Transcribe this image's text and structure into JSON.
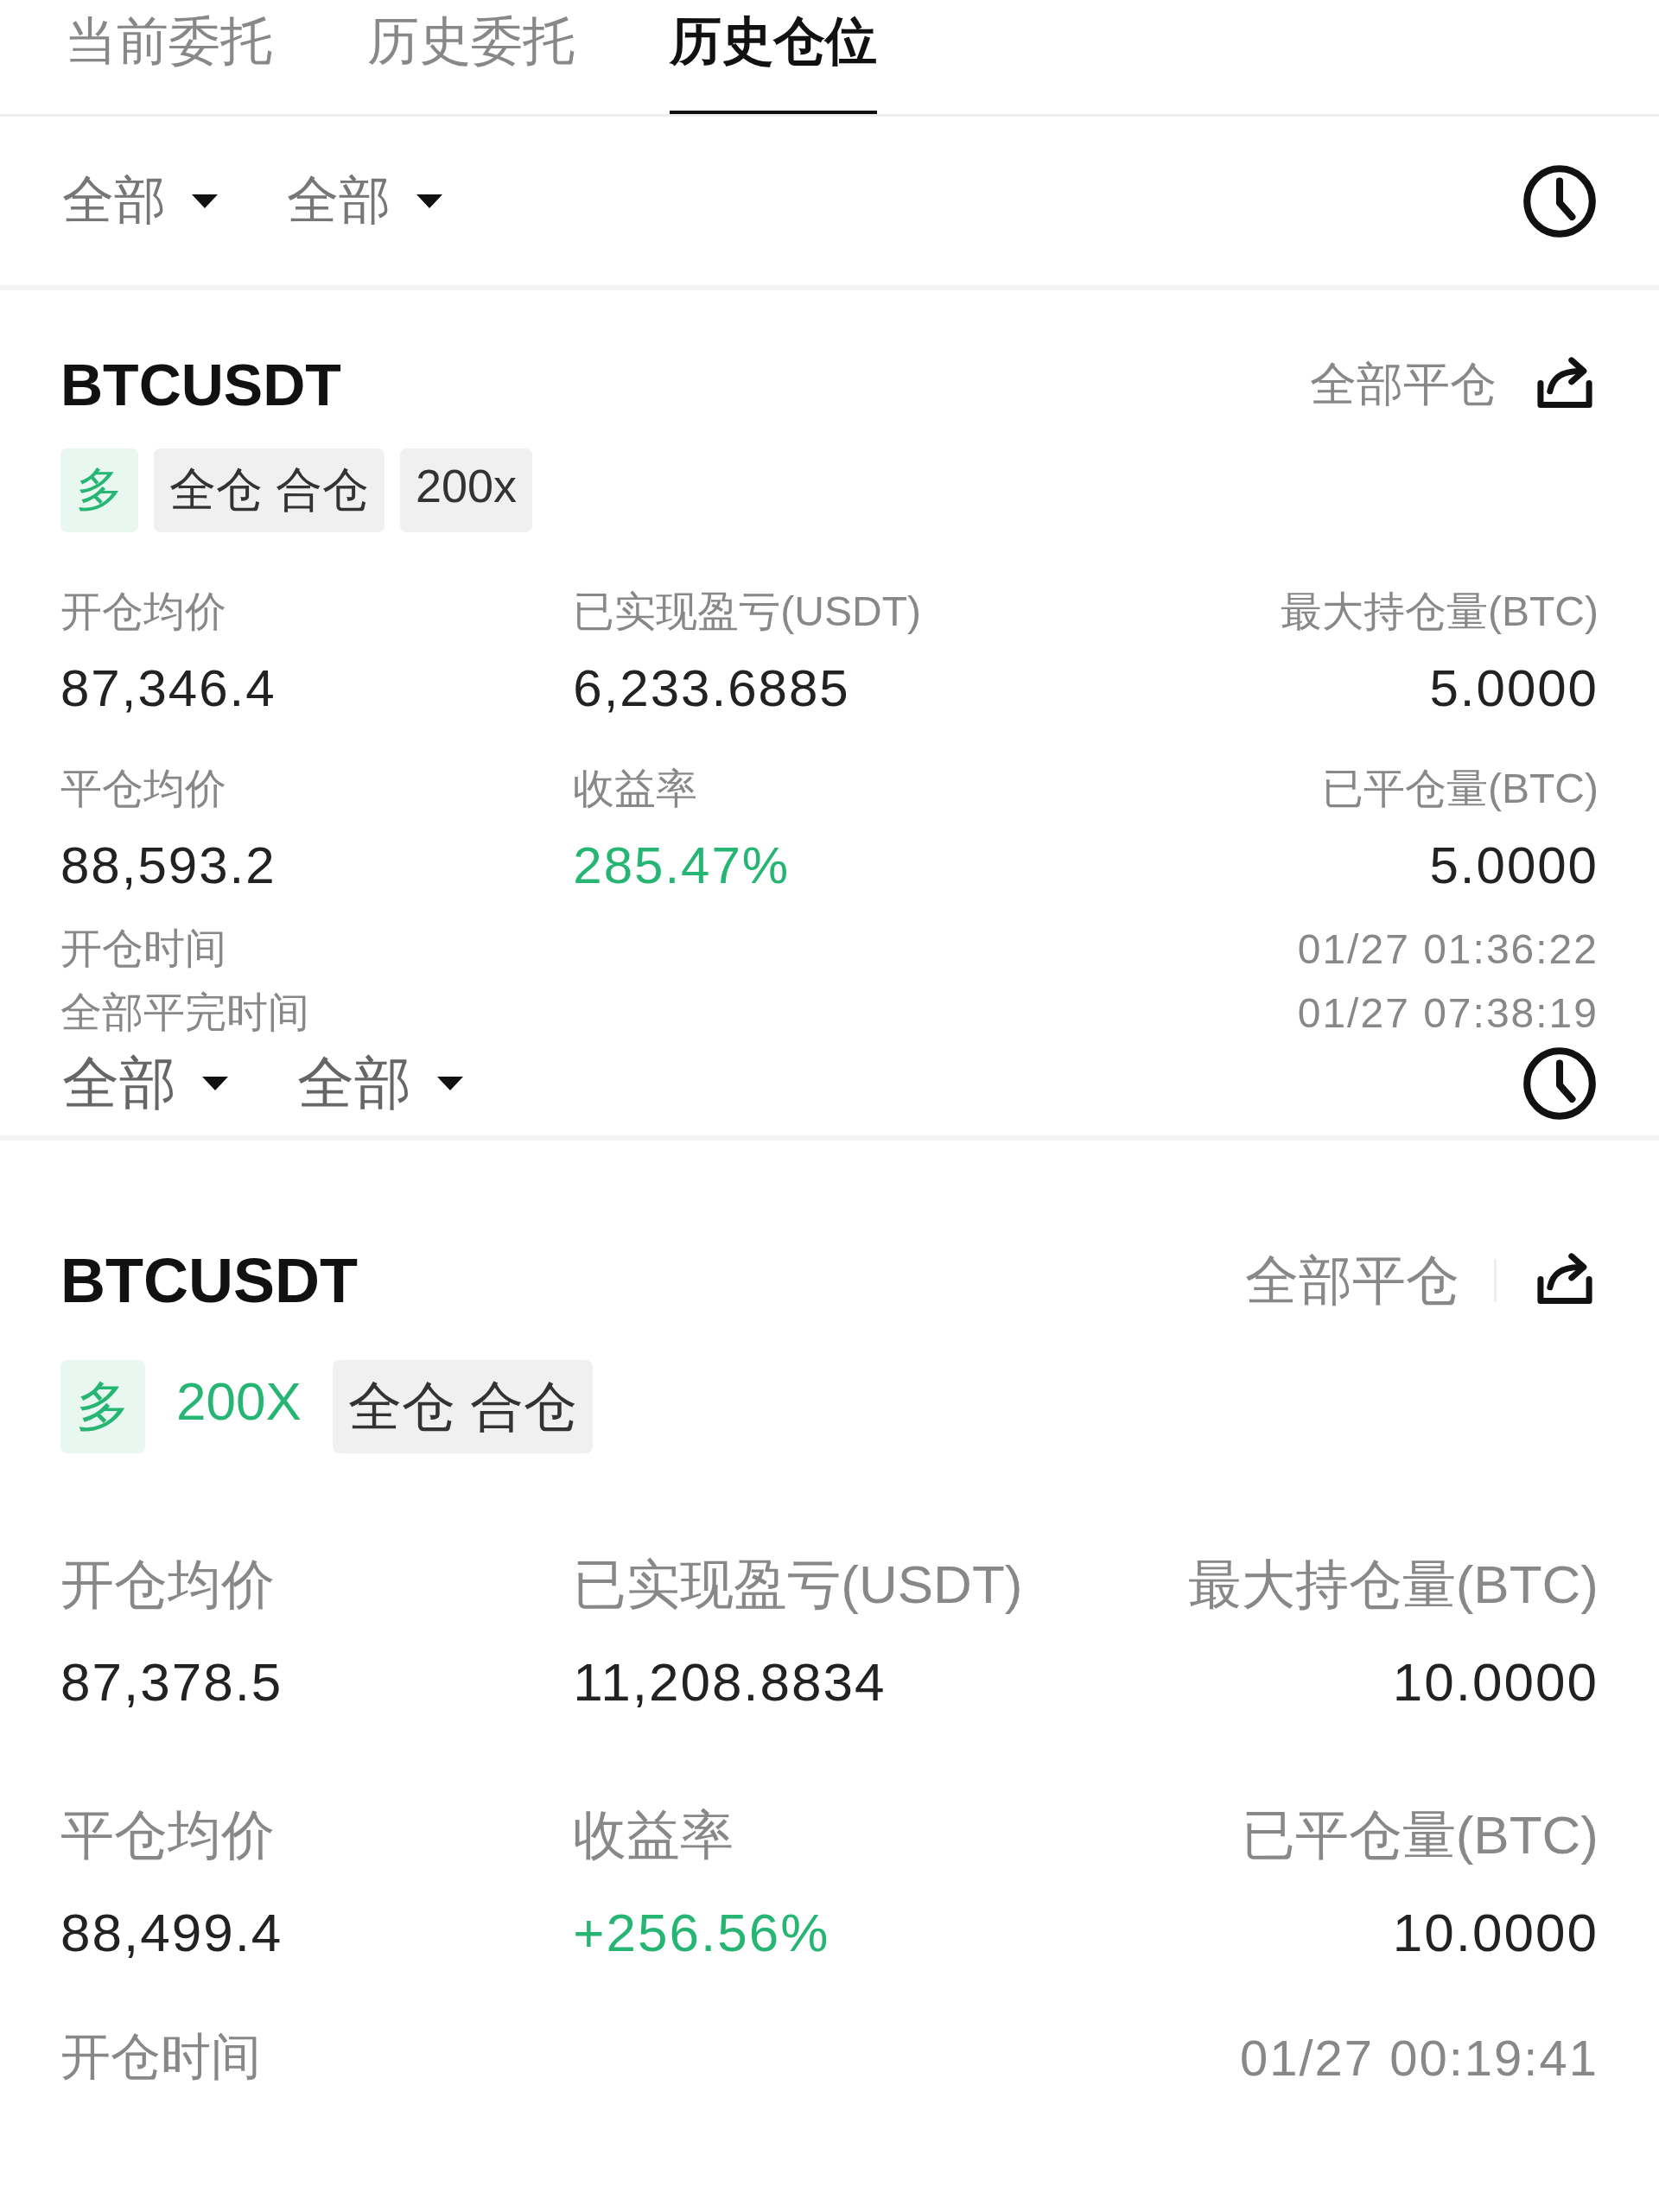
{
  "tabs": [
    {
      "label": "当前委托",
      "selected": false
    },
    {
      "label": "历史委托",
      "selected": false
    },
    {
      "label": "历史仓位",
      "selected": true
    }
  ],
  "sections": [
    {
      "filters": [
        "全部",
        "全部"
      ],
      "position": {
        "symbol": "BTCUSDT",
        "close_all": "全部平仓",
        "tags": [
          {
            "kind": "side",
            "text": "多"
          },
          {
            "kind": "grey",
            "text": "全仓 合仓"
          },
          {
            "kind": "grey",
            "text": "200x"
          }
        ],
        "stats": [
          {
            "label": "开仓均价",
            "value": "87,346.4",
            "kind": "number"
          },
          {
            "label": "已实现盈亏(USDT)",
            "value": "6,233.6885",
            "kind": "number"
          },
          {
            "label": "最大持仓量(BTC)",
            "value": "5.0000",
            "kind": "number"
          },
          {
            "label": "平仓均价",
            "value": "88,593.2",
            "kind": "number"
          },
          {
            "label": "收益率",
            "value": "285.47%",
            "kind": "profit"
          },
          {
            "label": "已平仓量(BTC)",
            "value": "5.0000",
            "kind": "number"
          }
        ],
        "times": [
          {
            "label": "开仓时间",
            "value": "01/27 01:36:22"
          },
          {
            "label": "全部平完时间",
            "value": "01/27 07:38:19"
          }
        ]
      }
    },
    {
      "filters": [
        "全部",
        "全部"
      ],
      "position": {
        "symbol": "BTCUSDT",
        "close_all": "全部平仓",
        "tags": [
          {
            "kind": "side",
            "text": "多"
          },
          {
            "kind": "green",
            "text": "200X"
          },
          {
            "kind": "grey",
            "text": "全仓 合仓"
          }
        ],
        "stats": [
          {
            "label": "开仓均价",
            "value": "87,378.5",
            "kind": "number"
          },
          {
            "label": "已实现盈亏(USDT)",
            "value": "11,208.8834",
            "kind": "number"
          },
          {
            "label": "最大持仓量(BTC)",
            "value": "10.0000",
            "kind": "number"
          },
          {
            "label": "平仓均价",
            "value": "88,499.4",
            "kind": "number"
          },
          {
            "label": "收益率",
            "value": "+256.56%",
            "kind": "profit"
          },
          {
            "label": "已平仓量(BTC)",
            "value": "10.0000",
            "kind": "number"
          }
        ],
        "times": [
          {
            "label": "开仓时间",
            "value": "01/27 00:19:41"
          }
        ]
      }
    }
  ]
}
